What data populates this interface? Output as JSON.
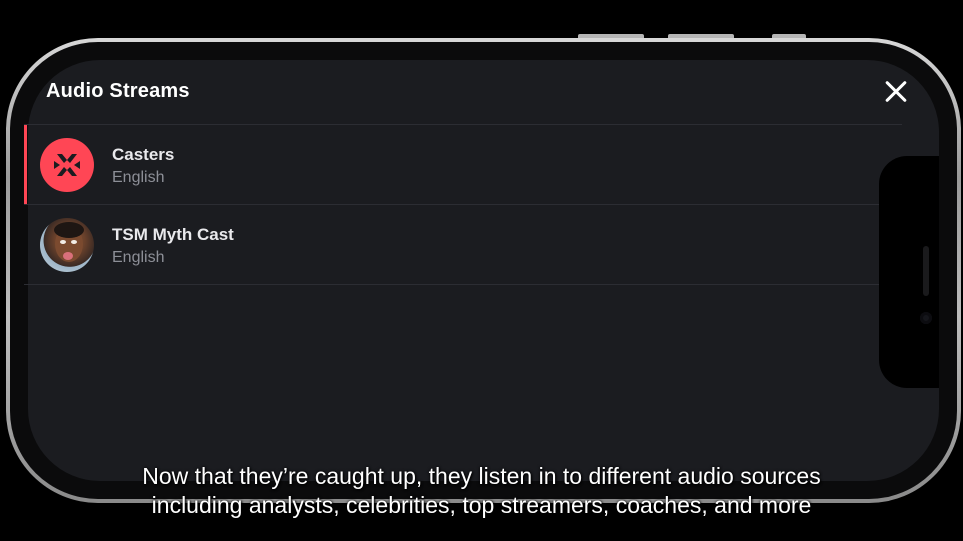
{
  "app": {
    "title": "Audio Streams",
    "accent_color": "#ff4655"
  },
  "header": {
    "title": "Audio Streams",
    "close_icon": "close-icon"
  },
  "streams": [
    {
      "name": "Casters",
      "language": "English",
      "avatar": "valorant-logo-icon",
      "selected": true
    },
    {
      "name": "TSM Myth Cast",
      "language": "English",
      "avatar": "streamer-avatar",
      "selected": false
    }
  ],
  "caption": {
    "line1": "Now that they’re caught up, they listen in to different audio sources",
    "line2": "including analysts, celebrities, top streamers, coaches, and more"
  }
}
